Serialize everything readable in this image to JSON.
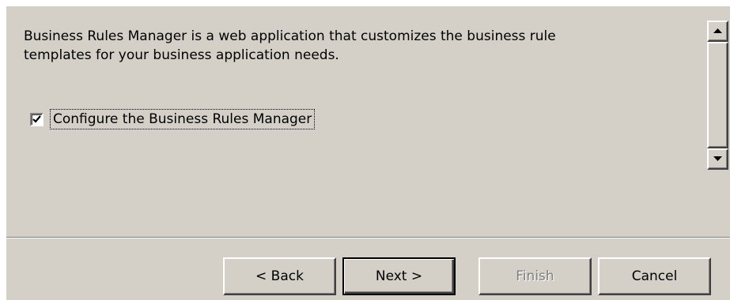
{
  "description": {
    "line1": "Business Rules Manager is a web application that customizes the business rule",
    "line2": "templates for your business application needs."
  },
  "checkbox": {
    "label": "Configure the Business Rules Manager",
    "checked": true
  },
  "buttons": {
    "back": "< Back",
    "next": "Next >",
    "finish": "Finish",
    "cancel": "Cancel"
  },
  "colors": {
    "dialog_bg": "#d4d0c8",
    "disabled_text": "#808080"
  },
  "icons": {
    "scroll_up": "triangle-up",
    "scroll_down": "triangle-down",
    "checkbox_mark": "checkmark"
  }
}
